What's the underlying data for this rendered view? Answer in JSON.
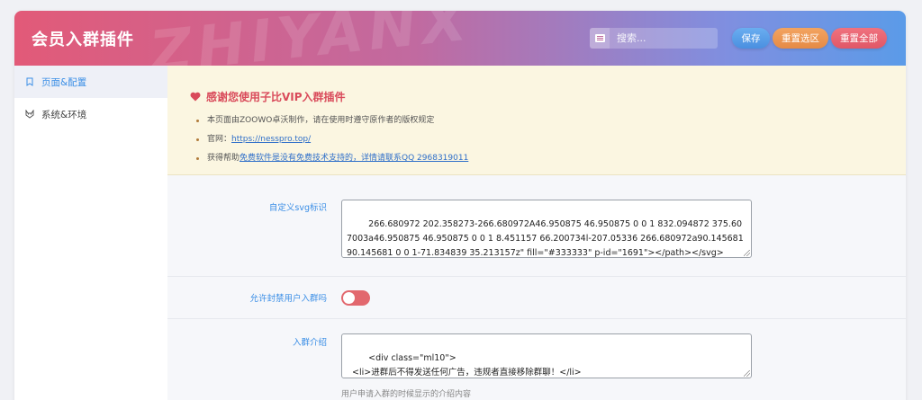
{
  "header": {
    "title": "会员入群插件",
    "watermark": "ZHIYANX",
    "search": {
      "placeholder": "搜索...",
      "icon": "list-icon"
    },
    "buttons": {
      "save": "保存",
      "reset_selected": "重置选区",
      "reset_all": "重置全部"
    },
    "colors": {
      "save": "#4a8fe0",
      "reset_selected": "#e58a45",
      "reset_all": "#e05767"
    }
  },
  "sidebar": {
    "items": [
      {
        "label": "页面&配置",
        "icon": "bookmark-icon",
        "active": true
      },
      {
        "label": "系统&环境",
        "icon": "wolf-icon",
        "active": false
      }
    ]
  },
  "notice": {
    "title": "感谢您使用子比VIP入群插件",
    "items": [
      {
        "text": "本页面由ZOOWO卓沃制作，请在使用时遵守原作者的版权规定"
      },
      {
        "prefix": "官网：",
        "link": "https://nesspro.top/"
      },
      {
        "prefix": "获得帮助",
        "link": "免费软件是没有免费技术支持的，详情请联系QQ 2968319011"
      }
    ]
  },
  "fields": {
    "svg": {
      "label": "自定义svg标识",
      "value": "266.680972 202.358273-266.680972A46.950875 46.950875 0 0 1 832.094872 375.607003a46.950875 46.950875 0 0 1 8.451157 66.200734l-207.05336 266.680972a90.145681 90.145681 0 0 1-71.834839 35.213157z\" fill=\"#333333\" p-id=\"1691\"></path></svg>"
    },
    "allow_ban": {
      "label": "允许封禁用户入群吗",
      "enabled": false
    },
    "intro": {
      "label": "入群介绍",
      "value": "<div class=\"ml10\">\n  <li>进群后不得发送任何广告，违规者直接移除群聊！</li>\n  <li>不得私自透露本群QQ，违规者永久封号且VIP款项不退回</li>",
      "hint": "用户申请入群的时候显示的介绍内容"
    }
  }
}
